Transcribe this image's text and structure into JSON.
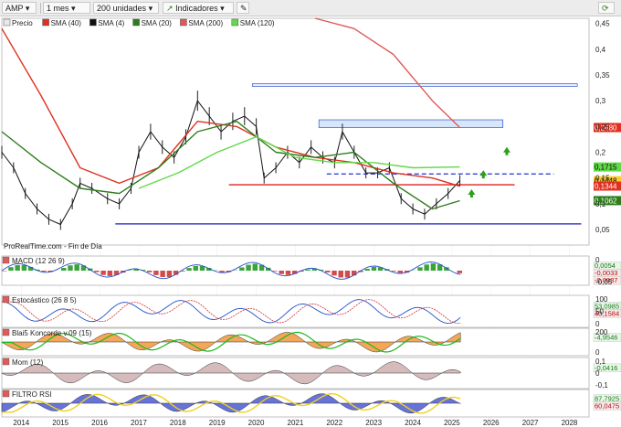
{
  "toolbar": {
    "symbol": "AMP",
    "period": "1 mes",
    "units": "200 unidades",
    "indicators": "Indicadores"
  },
  "source_label": "ProRealTime.com - Fin de Día",
  "legend": [
    {
      "label": "Precio",
      "color": "#e8e8e8"
    },
    {
      "label": "SMA (40)",
      "color": "#e03020"
    },
    {
      "label": "SMA (4)",
      "color": "#111111"
    },
    {
      "label": "SMA (20)",
      "color": "#2e7d1c"
    },
    {
      "label": "SMA (200)",
      "color": "#e05a5a"
    },
    {
      "label": "SMA (120)",
      "color": "#62d94a"
    }
  ],
  "chart_data": [
    {
      "type": "line",
      "panel": "price",
      "x_ticks": [
        "2014",
        "2015",
        "2016",
        "2017",
        "2018",
        "2019",
        "2020",
        "2021",
        "2022",
        "2023",
        "2024",
        "2025",
        "2026",
        "2027",
        "2028"
      ],
      "y_ticks": [
        "0,45",
        "0,4",
        "0,35",
        "0,3",
        "0,25",
        "0,2",
        "0,15",
        "0,1",
        "0,05"
      ],
      "ylim": [
        0.02,
        0.46
      ],
      "price_tags": [
        {
          "label": "0,2480",
          "value": 0.248,
          "color": "#e03020"
        },
        {
          "label": "0,1715",
          "value": 0.1715,
          "color": "#62d94a"
        },
        {
          "label": "0,1448",
          "value": 0.1448,
          "color": "#ffcc33"
        },
        {
          "label": "0,1344",
          "value": 0.1344,
          "color": "#e03020"
        },
        {
          "label": "0,1062",
          "value": 0.1062,
          "color": "#2e7d1c"
        }
      ],
      "series": [
        {
          "name": "Precio",
          "color": "#111111",
          "x": [
            2013.5,
            2013.8,
            2014.1,
            2014.4,
            2014.7,
            2015.0,
            2015.3,
            2015.5,
            2015.8,
            2016.2,
            2016.5,
            2016.8,
            2017.0,
            2017.3,
            2017.6,
            2017.9,
            2018.2,
            2018.5,
            2018.8,
            2019.1,
            2019.4,
            2019.7,
            2020.0,
            2020.2,
            2020.5,
            2020.8,
            2021.1,
            2021.4,
            2021.7,
            2022.0,
            2022.2,
            2022.5,
            2022.8,
            2023.1,
            2023.4,
            2023.7,
            2024.0,
            2024.3,
            2024.6,
            2024.9,
            2025.2
          ],
          "y": [
            0.2,
            0.17,
            0.12,
            0.09,
            0.07,
            0.06,
            0.1,
            0.14,
            0.13,
            0.11,
            0.1,
            0.13,
            0.2,
            0.24,
            0.21,
            0.19,
            0.23,
            0.3,
            0.27,
            0.24,
            0.26,
            0.27,
            0.25,
            0.15,
            0.17,
            0.2,
            0.18,
            0.21,
            0.19,
            0.18,
            0.24,
            0.2,
            0.16,
            0.16,
            0.17,
            0.11,
            0.09,
            0.08,
            0.1,
            0.12,
            0.145
          ]
        },
        {
          "name": "SMA (40)",
          "color": "#e03020",
          "x": [
            2013.5,
            2014.5,
            2015.5,
            2016.5,
            2017.5,
            2018.5,
            2019.5,
            2020.5,
            2021.5,
            2022.5,
            2023.5,
            2024.5,
            2025.2
          ],
          "y": [
            0.44,
            0.31,
            0.17,
            0.14,
            0.17,
            0.26,
            0.25,
            0.21,
            0.19,
            0.18,
            0.16,
            0.15,
            0.134
          ]
        },
        {
          "name": "SMA (20)",
          "color": "#2e7d1c",
          "x": [
            2013.5,
            2014.5,
            2015.5,
            2016.5,
            2017.5,
            2018.5,
            2019.5,
            2020.5,
            2021.5,
            2022.5,
            2023.5,
            2024.5,
            2025.2
          ],
          "y": [
            0.24,
            0.18,
            0.13,
            0.12,
            0.17,
            0.24,
            0.26,
            0.2,
            0.19,
            0.2,
            0.14,
            0.09,
            0.106
          ]
        },
        {
          "name": "SMA (200)",
          "color": "#e05a5a",
          "x": [
            2021.5,
            2022.5,
            2023.5,
            2024.5,
            2025.2
          ],
          "y": [
            0.46,
            0.44,
            0.39,
            0.3,
            0.248
          ]
        },
        {
          "name": "SMA (120)",
          "color": "#62d94a",
          "x": [
            2017.0,
            2018.0,
            2019.0,
            2020.0,
            2021.0,
            2022.0,
            2023.0,
            2024.0,
            2025.2
          ],
          "y": [
            0.13,
            0.16,
            0.2,
            0.23,
            0.19,
            0.18,
            0.18,
            0.17,
            0.1715
          ]
        }
      ]
    },
    {
      "type": "bar",
      "panel": "macd",
      "title": "MACD (12 26 9)",
      "values": [
        "0,0054",
        "-0,0033",
        "-0,0087"
      ],
      "y_ticks": [
        "0",
        "-0,05"
      ]
    },
    {
      "type": "line",
      "panel": "stochastic",
      "title": "Estocástico (26 8 5)",
      "values": [
        "53,0985",
        "40,1584"
      ],
      "y_ticks": [
        "100",
        "50",
        "0"
      ]
    },
    {
      "type": "area",
      "panel": "koncorde",
      "title": "Blai5 Koncorde v.09 (15)",
      "values": [
        "-4,9546"
      ],
      "y_ticks": [
        "200",
        "0"
      ]
    },
    {
      "type": "area",
      "panel": "momentum",
      "title": "Mom (12)",
      "values": [
        "-0,0416"
      ],
      "y_ticks": [
        "0,1",
        "0",
        "-0,1"
      ]
    },
    {
      "type": "area",
      "panel": "rsi",
      "title": "FILTRO RSI",
      "values": [
        "87,7925",
        "60,0475"
      ],
      "y_ticks": []
    }
  ]
}
